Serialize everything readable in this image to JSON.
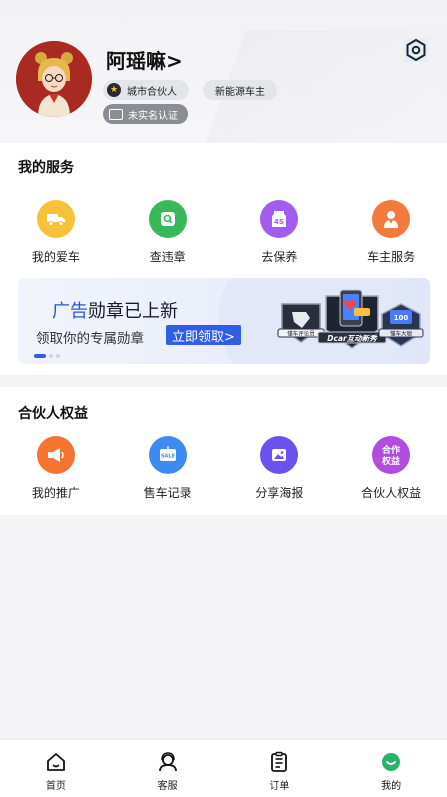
{
  "profile": {
    "username": "阿瑶嘛>",
    "badge_partner": "城市合伙人",
    "badge_ev": "新能源车主",
    "verify_status": "未实名认证"
  },
  "services": {
    "title": "我的服务",
    "items": [
      {
        "label": "我的爱车",
        "icon": "car-icon",
        "color": "#f5c23a"
      },
      {
        "label": "查违章",
        "icon": "search-icon",
        "color": "#39b859"
      },
      {
        "label": "去保养",
        "icon": "4s-icon",
        "color": "#a35cf0"
      },
      {
        "label": "车主服务",
        "icon": "service-person-icon",
        "color": "#f27a3c"
      }
    ]
  },
  "banner": {
    "title_highlight": "广告",
    "title_rest": "勋章已上新",
    "subtitle": "领取你的专属勋章",
    "cta": "立即领取>",
    "medal_1": "懂车评论员",
    "medal_2": "Dcar互动新秀",
    "medal_3": "懂车大咖"
  },
  "partner": {
    "title": "合伙人权益",
    "items": [
      {
        "label": "我的推广",
        "icon": "megaphone-icon",
        "color": "#f5742f"
      },
      {
        "label": "售车记录",
        "icon": "sale-tag-icon",
        "color": "#3e8af2"
      },
      {
        "label": "分享海报",
        "icon": "image-icon",
        "color": "#6a52f0"
      },
      {
        "label": "合伙人权益",
        "icon": "partner-rights-icon",
        "color": "#b04ce0",
        "icon_text": "合作\n权益"
      }
    ]
  },
  "tabbar": {
    "items": [
      {
        "label": "首页",
        "icon": "home-icon"
      },
      {
        "label": "客服",
        "icon": "headset-icon"
      },
      {
        "label": "订单",
        "icon": "order-icon"
      },
      {
        "label": "我的",
        "icon": "profile-icon",
        "active": true,
        "active_color": "#2cb36a"
      }
    ]
  }
}
